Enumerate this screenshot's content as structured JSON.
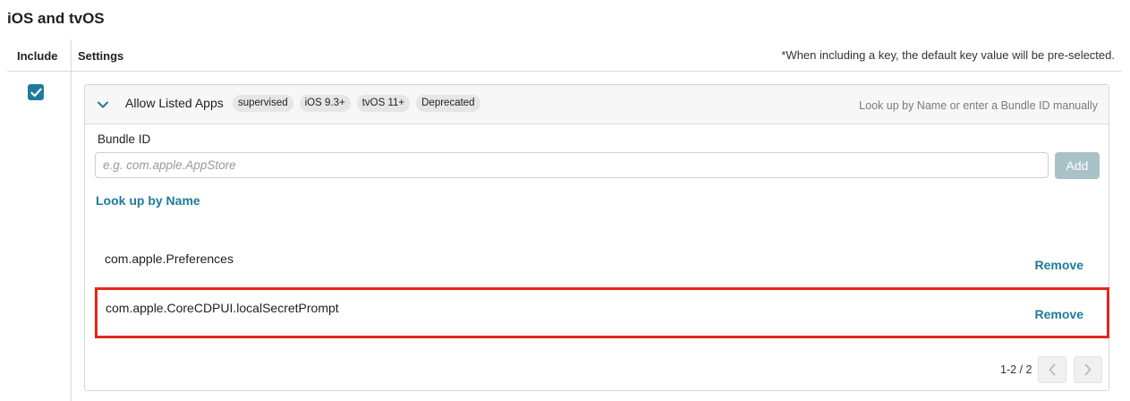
{
  "section": {
    "title": "iOS and tvOS"
  },
  "table": {
    "col_include": "Include",
    "col_settings": "Settings",
    "note": "*When including a key, the default key value will be pre-selected."
  },
  "include_checked": true,
  "panel": {
    "title": "Allow Listed Apps",
    "badges": [
      "supervised",
      "iOS 9.3+",
      "tvOS 11+",
      "Deprecated"
    ],
    "hint": "Look up by Name or enter a Bundle ID manually",
    "bundle_label": "Bundle ID",
    "bundle_value": "",
    "bundle_placeholder": "e.g. com.apple.AppStore",
    "add_label": "Add",
    "lookup_label": "Look up by Name",
    "apps": [
      {
        "id": "com.apple.Preferences",
        "action": "Remove"
      },
      {
        "id": "com.apple.CoreCDPUI.localSecretPrompt",
        "action": "Remove"
      }
    ],
    "pager": {
      "text": "1-2 / 2"
    }
  },
  "colors": {
    "accent": "#1f7b9c",
    "highlight": "#e3261b",
    "add_disabled": "#a9c2c7"
  },
  "icons": {
    "check": "check-icon",
    "chevron": "chevron-down-icon",
    "prev": "chevron-left-icon",
    "next": "chevron-right-icon"
  }
}
